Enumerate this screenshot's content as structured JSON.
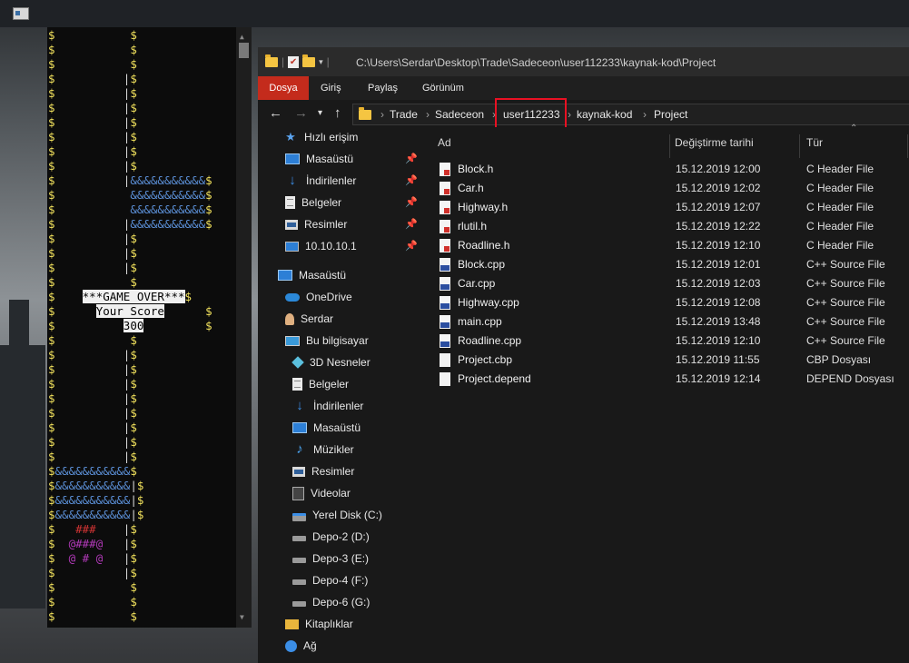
{
  "console": {
    "lines": [
      [
        [
          "$",
          "y"
        ],
        [
          "           ",
          ""
        ],
        [
          "$",
          "y"
        ]
      ],
      [
        [
          "$",
          "y"
        ],
        [
          "           ",
          ""
        ],
        [
          "$",
          "y"
        ]
      ],
      [
        [
          "$",
          "y"
        ],
        [
          "           ",
          ""
        ],
        [
          "$",
          "y"
        ]
      ],
      [
        [
          "$",
          "y"
        ],
        [
          "          ",
          ""
        ],
        [
          "|",
          "w"
        ],
        [
          "$",
          "y"
        ]
      ],
      [
        [
          "$",
          "y"
        ],
        [
          "          ",
          ""
        ],
        [
          "|",
          "w"
        ],
        [
          "$",
          "y"
        ]
      ],
      [
        [
          "$",
          "y"
        ],
        [
          "          ",
          ""
        ],
        [
          "|",
          "w"
        ],
        [
          "$",
          "y"
        ]
      ],
      [
        [
          "$",
          "y"
        ],
        [
          "          ",
          ""
        ],
        [
          "|",
          "w"
        ],
        [
          "$",
          "y"
        ]
      ],
      [
        [
          "$",
          "y"
        ],
        [
          "          ",
          ""
        ],
        [
          "|",
          "w"
        ],
        [
          "$",
          "y"
        ]
      ],
      [
        [
          "$",
          "y"
        ],
        [
          "          ",
          ""
        ],
        [
          "|",
          "w"
        ],
        [
          "$",
          "y"
        ]
      ],
      [
        [
          "$",
          "y"
        ],
        [
          "          ",
          ""
        ],
        [
          "|",
          "w"
        ],
        [
          "$",
          "y"
        ]
      ],
      [
        [
          "$",
          "y"
        ],
        [
          "          ",
          ""
        ],
        [
          "|",
          "w"
        ],
        [
          "&&&&&&&&&&&",
          "b"
        ],
        [
          "$",
          "y"
        ]
      ],
      [
        [
          "$",
          "y"
        ],
        [
          "           ",
          ""
        ],
        [
          "&&&&&&&&&&&",
          "b"
        ],
        [
          "$",
          "y"
        ]
      ],
      [
        [
          "$",
          "y"
        ],
        [
          "           ",
          ""
        ],
        [
          "&&&&&&&&&&&",
          "b"
        ],
        [
          "$",
          "y"
        ]
      ],
      [
        [
          "$",
          "y"
        ],
        [
          "          ",
          ""
        ],
        [
          "|",
          "w"
        ],
        [
          "&&&&&&&&&&&",
          "b"
        ],
        [
          "$",
          "y"
        ]
      ],
      [
        [
          "$",
          "y"
        ],
        [
          "          ",
          ""
        ],
        [
          "|",
          "w"
        ],
        [
          "$",
          "y"
        ]
      ],
      [
        [
          "$",
          "y"
        ],
        [
          "          ",
          ""
        ],
        [
          "|",
          "w"
        ],
        [
          "$",
          "y"
        ]
      ],
      [
        [
          "$",
          "y"
        ],
        [
          "          ",
          ""
        ],
        [
          "|",
          "w"
        ],
        [
          "$",
          "y"
        ]
      ],
      [
        [
          "$",
          "y"
        ],
        [
          "           ",
          ""
        ],
        [
          "$",
          "y"
        ]
      ],
      [
        [
          "$",
          "y"
        ],
        [
          "    ",
          ""
        ],
        [
          "***GAME OVER***",
          "go"
        ],
        [
          "$",
          "y"
        ]
      ],
      [
        [
          "$",
          "y"
        ],
        [
          "      ",
          ""
        ],
        [
          "Your Score",
          "go"
        ],
        [
          "      ",
          ""
        ],
        [
          "$",
          "y"
        ]
      ],
      [
        [
          "$",
          "y"
        ],
        [
          "          ",
          ""
        ],
        [
          "300",
          "go"
        ],
        [
          "         ",
          ""
        ],
        [
          "$",
          "y"
        ]
      ],
      [
        [
          "$",
          "y"
        ],
        [
          "           ",
          ""
        ],
        [
          "$",
          "y"
        ]
      ],
      [
        [
          "$",
          "y"
        ],
        [
          "          ",
          ""
        ],
        [
          "|",
          "w"
        ],
        [
          "$",
          "y"
        ]
      ],
      [
        [
          "$",
          "y"
        ],
        [
          "          ",
          ""
        ],
        [
          "|",
          "w"
        ],
        [
          "$",
          "y"
        ]
      ],
      [
        [
          "$",
          "y"
        ],
        [
          "          ",
          ""
        ],
        [
          "|",
          "w"
        ],
        [
          "$",
          "y"
        ]
      ],
      [
        [
          "$",
          "y"
        ],
        [
          "          ",
          ""
        ],
        [
          "|",
          "w"
        ],
        [
          "$",
          "y"
        ]
      ],
      [
        [
          "$",
          "y"
        ],
        [
          "          ",
          ""
        ],
        [
          "|",
          "w"
        ],
        [
          "$",
          "y"
        ]
      ],
      [
        [
          "$",
          "y"
        ],
        [
          "          ",
          ""
        ],
        [
          "|",
          "w"
        ],
        [
          "$",
          "y"
        ]
      ],
      [
        [
          "$",
          "y"
        ],
        [
          "          ",
          ""
        ],
        [
          "|",
          "w"
        ],
        [
          "$",
          "y"
        ]
      ],
      [
        [
          "$",
          "y"
        ],
        [
          "          ",
          ""
        ],
        [
          "|",
          "w"
        ],
        [
          "$",
          "y"
        ]
      ],
      [
        [
          "$",
          "y"
        ],
        [
          "&&&&&&&&&&&",
          "b"
        ],
        [
          "$",
          "y"
        ]
      ],
      [
        [
          "$",
          "y"
        ],
        [
          "&&&&&&&&&&&",
          "b"
        ],
        [
          "|",
          "w"
        ],
        [
          "$",
          "y"
        ]
      ],
      [
        [
          "$",
          "y"
        ],
        [
          "&&&&&&&&&&&",
          "b"
        ],
        [
          "|",
          "w"
        ],
        [
          "$",
          "y"
        ]
      ],
      [
        [
          "$",
          "y"
        ],
        [
          "&&&&&&&&&&&",
          "b"
        ],
        [
          "|",
          "w"
        ],
        [
          "$",
          "y"
        ]
      ],
      [
        [
          "$",
          "y"
        ],
        [
          "   ",
          ""
        ],
        [
          "###",
          "r"
        ],
        [
          "    ",
          ""
        ],
        [
          "|",
          "w"
        ],
        [
          "$",
          "y"
        ]
      ],
      [
        [
          "$",
          "y"
        ],
        [
          "  ",
          ""
        ],
        [
          "@###@",
          "m"
        ],
        [
          "   ",
          ""
        ],
        [
          "|",
          "w"
        ],
        [
          "$",
          "y"
        ]
      ],
      [
        [
          "$",
          "y"
        ],
        [
          "  ",
          ""
        ],
        [
          "@ # @",
          "m"
        ],
        [
          "   ",
          ""
        ],
        [
          "|",
          "w"
        ],
        [
          "$",
          "y"
        ]
      ],
      [
        [
          "$",
          "y"
        ],
        [
          "          ",
          ""
        ],
        [
          "|",
          "w"
        ],
        [
          "$",
          "y"
        ]
      ],
      [
        [
          "$",
          "y"
        ],
        [
          "           ",
          ""
        ],
        [
          "$",
          "y"
        ]
      ],
      [
        [
          "$",
          "y"
        ],
        [
          "           ",
          ""
        ],
        [
          "$",
          "y"
        ]
      ],
      [
        [
          "$",
          "y"
        ],
        [
          "           ",
          ""
        ],
        [
          "$",
          "y"
        ]
      ]
    ]
  },
  "explorer": {
    "title_path": "C:\\Users\\Serdar\\Desktop\\Trade\\Sadeceon\\user112233\\kaynak-kod\\Project",
    "ribbon": {
      "file": "Dosya",
      "home": "Giriş",
      "share": "Paylaş",
      "view": "Görünüm"
    },
    "breadcrumb": [
      "Trade",
      "Sadeceon",
      "user112233",
      "kaynak-kod",
      "Project"
    ],
    "columns": {
      "name": "Ad",
      "date": "Değiştirme tarihi",
      "type": "Tür"
    },
    "sidebar": [
      {
        "label": "Hızlı erişim",
        "icon": "star-icon"
      },
      {
        "label": "Masaüstü",
        "icon": "desktop-icon"
      },
      {
        "label": "İndirilenler",
        "icon": "downloads-icon"
      },
      {
        "label": "Belgeler",
        "icon": "documents-icon"
      },
      {
        "label": "Resimler",
        "icon": "pictures-icon"
      },
      {
        "label": "10.10.10.1",
        "icon": "monitor-icon"
      },
      {
        "label": "Masaüstü",
        "icon": "desktop-icon"
      },
      {
        "label": "OneDrive",
        "icon": "cloud-icon"
      },
      {
        "label": "Serdar",
        "icon": "user-icon"
      },
      {
        "label": "Bu bilgisayar",
        "icon": "computer-icon"
      },
      {
        "label": "3D Nesneler",
        "icon": "3d-objects-icon"
      },
      {
        "label": "Belgeler",
        "icon": "documents-icon"
      },
      {
        "label": "İndirilenler",
        "icon": "downloads-icon"
      },
      {
        "label": "Masaüstü",
        "icon": "desktop-icon"
      },
      {
        "label": "Müzikler",
        "icon": "music-icon"
      },
      {
        "label": "Resimler",
        "icon": "pictures-icon"
      },
      {
        "label": "Videolar",
        "icon": "videos-icon"
      },
      {
        "label": "Yerel Disk (C:)",
        "icon": "system-drive-icon"
      },
      {
        "label": "Depo-2 (D:)",
        "icon": "drive-icon"
      },
      {
        "label": "Depo-3 (E:)",
        "icon": "drive-icon"
      },
      {
        "label": "Depo-4 (F:)",
        "icon": "drive-icon"
      },
      {
        "label": "Depo-6 (G:)",
        "icon": "drive-icon"
      },
      {
        "label": "Kitaplıklar",
        "icon": "libraries-icon"
      },
      {
        "label": "Ağ",
        "icon": "network-icon"
      }
    ],
    "files": [
      {
        "name": "Block.h",
        "date": "15.12.2019 12:00",
        "type": "C Header File",
        "kind": "h"
      },
      {
        "name": "Car.h",
        "date": "15.12.2019 12:02",
        "type": "C Header File",
        "kind": "h"
      },
      {
        "name": "Highway.h",
        "date": "15.12.2019 12:07",
        "type": "C Header File",
        "kind": "h"
      },
      {
        "name": "rlutil.h",
        "date": "15.12.2019 12:22",
        "type": "C Header File",
        "kind": "h"
      },
      {
        "name": "Roadline.h",
        "date": "15.12.2019 12:10",
        "type": "C Header File",
        "kind": "h"
      },
      {
        "name": "Block.cpp",
        "date": "15.12.2019 12:01",
        "type": "C++ Source File",
        "kind": "cpp"
      },
      {
        "name": "Car.cpp",
        "date": "15.12.2019 12:03",
        "type": "C++ Source File",
        "kind": "cpp"
      },
      {
        "name": "Highway.cpp",
        "date": "15.12.2019 12:08",
        "type": "C++ Source File",
        "kind": "cpp"
      },
      {
        "name": "main.cpp",
        "date": "15.12.2019 13:48",
        "type": "C++ Source File",
        "kind": "cpp"
      },
      {
        "name": "Roadline.cpp",
        "date": "15.12.2019 12:10",
        "type": "C++ Source File",
        "kind": "cpp"
      },
      {
        "name": "Project.cbp",
        "date": "15.12.2019 11:55",
        "type": "CBP Dosyası",
        "kind": "plain"
      },
      {
        "name": "Project.depend",
        "date": "15.12.2019 12:14",
        "type": "DEPEND Dosyası",
        "kind": "plain"
      }
    ]
  }
}
